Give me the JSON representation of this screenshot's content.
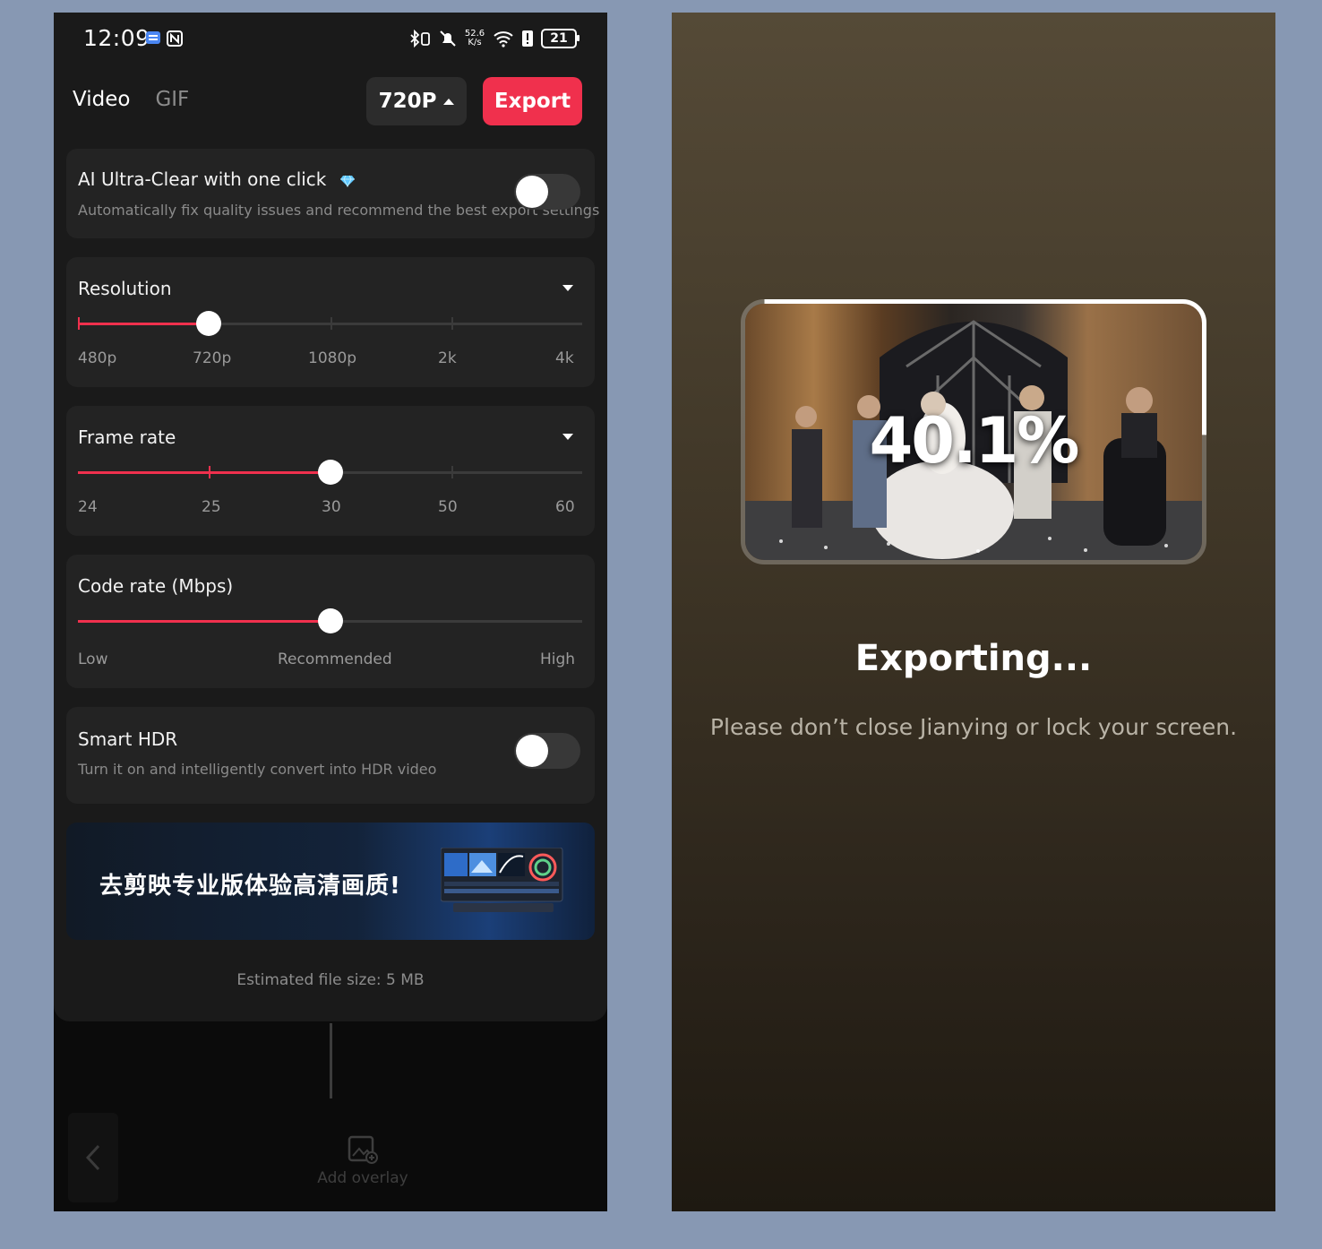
{
  "status_bar": {
    "time": "12:09",
    "net_speed_value": "52.6",
    "net_speed_unit": "K/s",
    "battery": "21"
  },
  "header": {
    "tabs": [
      {
        "label": "Video",
        "active": true
      },
      {
        "label": "GIF",
        "active": false
      }
    ],
    "resolution_button": "720P",
    "export_button": "Export",
    "accent_color": "#f0304d"
  },
  "ai_clear": {
    "title": "AI Ultra-Clear with one click",
    "subtitle": "Automatically fix quality issues and recommend the best export settings",
    "enabled": false
  },
  "resolution": {
    "title": "Resolution",
    "options": [
      "480p",
      "720p",
      "1080p",
      "2k",
      "4k"
    ],
    "selected": "720p",
    "selected_index": 1
  },
  "frame_rate": {
    "title": "Frame rate",
    "options": [
      "24",
      "25",
      "30",
      "50",
      "60"
    ],
    "selected": "30",
    "selected_index": 2
  },
  "code_rate": {
    "title": "Code rate (Mbps)",
    "labels": [
      "Low",
      "Recommended",
      "High"
    ],
    "value_fraction": 0.5
  },
  "smart_hdr": {
    "title": "Smart HDR",
    "subtitle": "Turn it on and intelligently convert into HDR video",
    "enabled": false
  },
  "banner": {
    "text": "去剪映专业版体验高清画质!"
  },
  "file_size": "Estimated file size: 5 MB",
  "bottom_toolbar": {
    "add_overlay": "Add overlay"
  },
  "export_screen": {
    "progress_text": "40.1%",
    "progress_fraction": 0.401,
    "title": "Exporting...",
    "hint": "Please don’t close Jianying or lock your screen."
  }
}
